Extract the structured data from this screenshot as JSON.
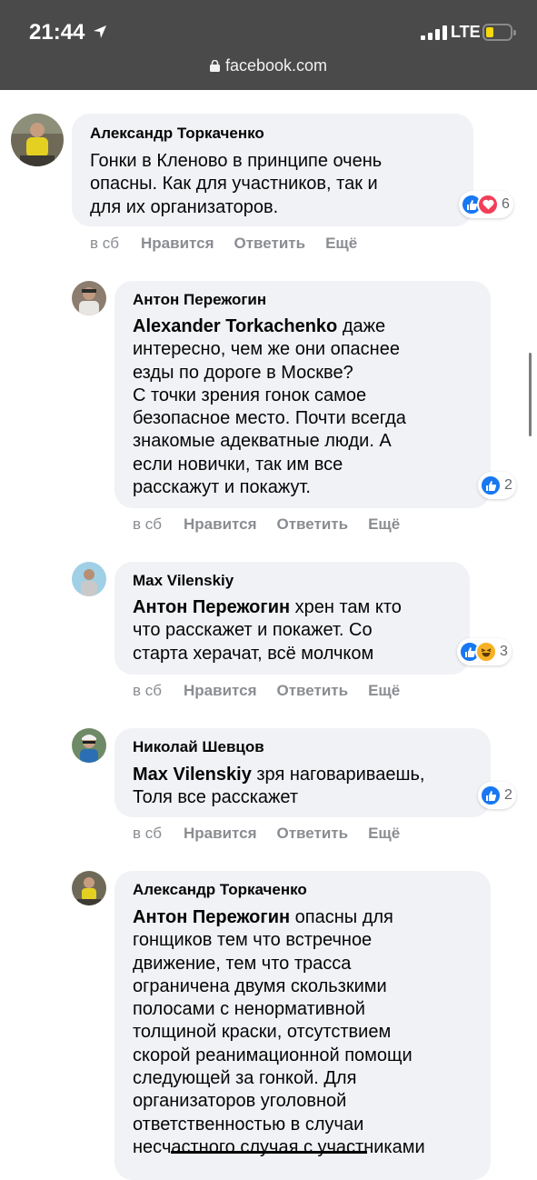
{
  "status_bar": {
    "time": "21:44",
    "network": "LTE",
    "url": "facebook.com"
  },
  "comments": [
    {
      "author": "Александр Торкаченко",
      "lines": [
        {
          "text": "Гонки в Кленово в принципе очень"
        },
        {
          "text": "опасны. Как для участников, так и"
        },
        {
          "text": "для их организаторов."
        }
      ],
      "reactions_count": "6",
      "reaction_icons": [
        "like",
        "love"
      ],
      "time": "в сб",
      "like": "Нравится",
      "reply": "Ответить",
      "more": "Ещё"
    },
    {
      "author": "Антон Пережогин",
      "lines": [
        {
          "mention": "Alexander Torkachenko",
          "text": " даже"
        },
        {
          "text": "интересно, чем же они опаснее"
        },
        {
          "text": "езды по дороге в Москве?"
        },
        {
          "text": "С точки зрения гонок самое"
        },
        {
          "text": "безопасное место. Почти всегда"
        },
        {
          "text": "знакомые адекватные люди. А"
        },
        {
          "text": "если новички, так им все"
        },
        {
          "text": "расскажут и покажут."
        }
      ],
      "reactions_count": "2",
      "reaction_icons": [
        "like"
      ],
      "time": "в сб",
      "like": "Нравится",
      "reply": "Ответить",
      "more": "Ещё"
    },
    {
      "author": "Max Vilenskiy",
      "lines": [
        {
          "mention": "Антон Пережогин",
          "text": " хрен там кто"
        },
        {
          "text": "что расскажет и покажет. Со"
        },
        {
          "text": "старта херачат, всё молчком"
        }
      ],
      "reactions_count": "3",
      "reaction_icons": [
        "like",
        "haha"
      ],
      "time": "в сб",
      "like": "Нравится",
      "reply": "Ответить",
      "more": "Ещё"
    },
    {
      "author": "Николай Шевцов",
      "lines": [
        {
          "mention": "Max Vilenskiy",
          "text": " зря наговариваешь,"
        },
        {
          "text": "Толя все расскажет"
        }
      ],
      "reactions_count": "2",
      "reaction_icons": [
        "like"
      ],
      "time": "в сб",
      "like": "Нравится",
      "reply": "Ответить",
      "more": "Ещё"
    },
    {
      "author": "Александр Торкаченко",
      "lines": [
        {
          "mention": "Антон Пережогин",
          "text": " опасны для"
        },
        {
          "text": "гонщиков тем что встречное"
        },
        {
          "text": "движение, тем что трасса"
        },
        {
          "text": "ограничена двумя скользкими"
        },
        {
          "text": "полосами с ненормативной"
        },
        {
          "text": "толщиной краски, отсутствием"
        },
        {
          "text": "скорой реанимационной помощи"
        },
        {
          "text": "следующей за гонкой. Для"
        },
        {
          "text": "организаторов уголовной"
        },
        {
          "text": "ответственностью в случаи"
        },
        {
          "text": "несчастного случая с участниками"
        }
      ]
    }
  ]
}
